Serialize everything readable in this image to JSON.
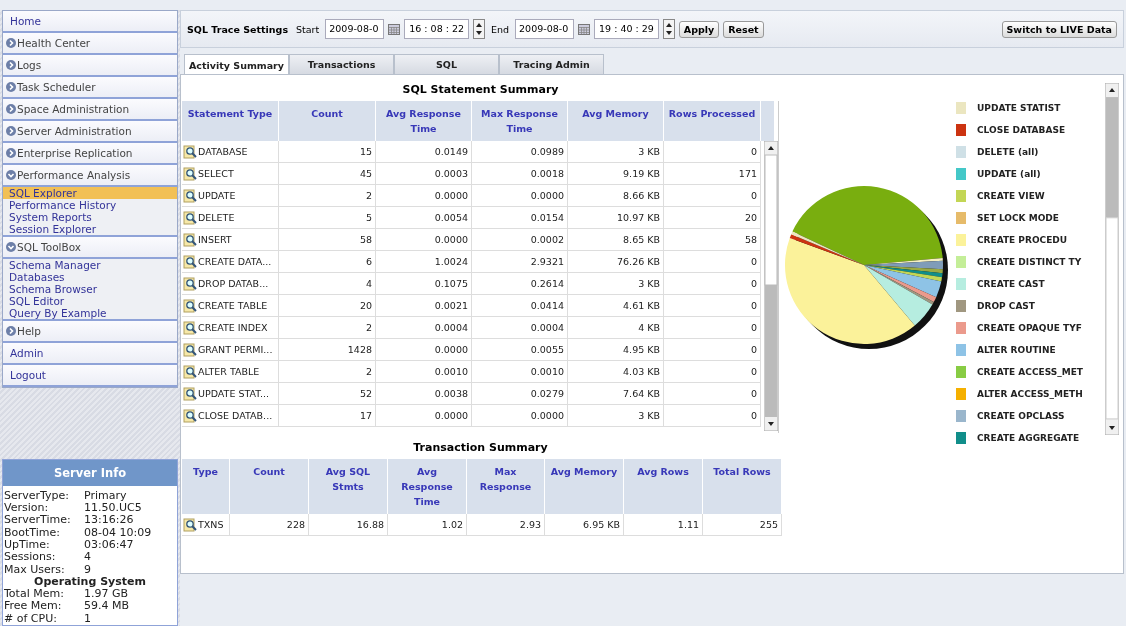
{
  "sidebar": {
    "items": [
      {
        "label": "Home",
        "kind": "link",
        "selected": false
      },
      {
        "label": "Health Center",
        "kind": "section",
        "expanded": false,
        "selected": false
      },
      {
        "label": "Logs",
        "kind": "section",
        "expanded": false,
        "selected": false
      },
      {
        "label": "Task Scheduler",
        "kind": "section",
        "expanded": false,
        "selected": false
      },
      {
        "label": "Space Administration",
        "kind": "section",
        "expanded": false,
        "selected": false
      },
      {
        "label": "Server Administration",
        "kind": "section",
        "expanded": false,
        "selected": false
      },
      {
        "label": "Enterprise Replication",
        "kind": "section",
        "expanded": false,
        "selected": false
      },
      {
        "label": "Performance Analysis",
        "kind": "section",
        "expanded": true,
        "selected": false,
        "children": [
          {
            "label": "SQL Explorer",
            "selected": true
          },
          {
            "label": "Performance History",
            "selected": false
          },
          {
            "label": "System Reports",
            "selected": false
          },
          {
            "label": "Session Explorer",
            "selected": false
          }
        ]
      },
      {
        "label": "SQL ToolBox",
        "kind": "section",
        "expanded": true,
        "selected": false,
        "children": [
          {
            "label": "Schema Manager",
            "selected": false
          },
          {
            "label": "Databases",
            "selected": false
          },
          {
            "label": "Schema Browser",
            "selected": false
          },
          {
            "label": "SQL Editor",
            "selected": false
          },
          {
            "label": "Query By Example",
            "selected": false
          }
        ]
      },
      {
        "label": "Help",
        "kind": "section",
        "expanded": false,
        "selected": false
      },
      {
        "label": "Admin",
        "kind": "link",
        "selected": false
      },
      {
        "label": "Logout",
        "kind": "link",
        "selected": false
      }
    ]
  },
  "server_info": {
    "title": "Server Info",
    "rows": [
      {
        "label": "ServerType:",
        "value": "Primary"
      },
      {
        "label": "Version:",
        "value": "11.50.UC5"
      },
      {
        "label": "ServerTime:",
        "value": "13:16:26"
      },
      {
        "label": "BootTime:",
        "value": "08-04 10:09"
      },
      {
        "label": "UpTime:",
        "value": "03:06:47"
      },
      {
        "label": "Sessions:",
        "value": "4"
      },
      {
        "label": "Max Users:",
        "value": "9"
      }
    ],
    "os_title": "Operating System",
    "os_rows": [
      {
        "label": "Total Mem:",
        "value": "1.97 GB"
      },
      {
        "label": "Free Mem:",
        "value": "59.4 MB"
      },
      {
        "label": "# of CPU:",
        "value": "1"
      }
    ]
  },
  "trace_settings": {
    "title": "SQL Trace Settings",
    "start_label": "Start",
    "start_date": "2009-08-0",
    "start_time": "16 : 08 : 22",
    "end_label": "End",
    "end_date": "2009-08-0",
    "end_time": "19 : 40 : 29",
    "apply": "Apply",
    "reset": "Reset",
    "live_button": "Switch to LIVE Data"
  },
  "tabs": [
    {
      "label": "Activity Summary",
      "selected": true
    },
    {
      "label": "Transactions",
      "selected": false
    },
    {
      "label": "SQL",
      "selected": false
    },
    {
      "label": "Tracing Admin",
      "selected": false
    }
  ],
  "statement_summary": {
    "title": "SQL Statement Summary",
    "columns": [
      "Statement Type",
      "Count",
      "Avg Response Time",
      "Max Response Time",
      "Avg Memory",
      "Rows Processed"
    ],
    "rows": [
      [
        "DATABASE",
        "15",
        "0.0149",
        "0.0989",
        "3 KB",
        "0"
      ],
      [
        "SELECT",
        "45",
        "0.0003",
        "0.0018",
        "9.19 KB",
        "171"
      ],
      [
        "UPDATE",
        "2",
        "0.0000",
        "0.0000",
        "8.66 KB",
        "0"
      ],
      [
        "DELETE",
        "5",
        "0.0054",
        "0.0154",
        "10.97 KB",
        "20"
      ],
      [
        "INSERT",
        "58",
        "0.0000",
        "0.0002",
        "8.65 KB",
        "58"
      ],
      [
        "CREATE DATA...",
        "6",
        "1.0024",
        "2.9321",
        "76.26 KB",
        "0"
      ],
      [
        "DROP DATAB...",
        "4",
        "0.1075",
        "0.2614",
        "3 KB",
        "0"
      ],
      [
        "CREATE TABLE",
        "20",
        "0.0021",
        "0.0414",
        "4.61 KB",
        "0"
      ],
      [
        "CREATE INDEX",
        "2",
        "0.0004",
        "0.0004",
        "4 KB",
        "0"
      ],
      [
        "GRANT PERMI...",
        "1428",
        "0.0000",
        "0.0055",
        "4.95 KB",
        "0"
      ],
      [
        "ALTER TABLE",
        "2",
        "0.0010",
        "0.0010",
        "4.03 KB",
        "0"
      ],
      [
        "UPDATE STAT...",
        "52",
        "0.0038",
        "0.0279",
        "7.64 KB",
        "0"
      ],
      [
        "CLOSE DATAB...",
        "17",
        "0.0000",
        "0.0000",
        "3 KB",
        "0"
      ]
    ]
  },
  "legend": [
    {
      "label": "UPDATE STATIST",
      "color": "#ebe6c0"
    },
    {
      "label": "CLOSE DATABASE",
      "color": "#cc3311"
    },
    {
      "label": "DELETE (all)",
      "color": "#cfe0e6"
    },
    {
      "label": "UPDATE (all)",
      "color": "#44c8c8"
    },
    {
      "label": "CREATE VIEW",
      "color": "#c3d655"
    },
    {
      "label": "SET LOCK MODE",
      "color": "#e6bb6a"
    },
    {
      "label": "CREATE PROCEDU",
      "color": "#fbf29a"
    },
    {
      "label": "CREATE DISTINCT TY",
      "color": "#c4ee98"
    },
    {
      "label": "CREATE CAST",
      "color": "#b6ede0"
    },
    {
      "label": "DROP CAST",
      "color": "#a09780"
    },
    {
      "label": "CREATE OPAQUE TYF",
      "color": "#eb9a8c"
    },
    {
      "label": "ALTER ROUTINE",
      "color": "#8ec3e6"
    },
    {
      "label": "CREATE ACCESS_MET",
      "color": "#88cc44"
    },
    {
      "label": "ALTER ACCESS_METH",
      "color": "#f5b000"
    },
    {
      "label": "CREATE OPCLASS",
      "color": "#9ab6cc"
    },
    {
      "label": "CREATE AGGREGATE",
      "color": "#118e8a"
    }
  ],
  "transaction_summary": {
    "title": "Transaction Summary",
    "columns": [
      "Type",
      "Count",
      "Avg SQL Stmts",
      "Avg Response Time",
      "Max Response",
      "Avg Memory",
      "Avg Rows",
      "Total Rows"
    ],
    "rows": [
      [
        "TXNS",
        "228",
        "16.88",
        "1.02",
        "2.93",
        "6.95 KB",
        "1.11",
        "255"
      ]
    ]
  }
}
